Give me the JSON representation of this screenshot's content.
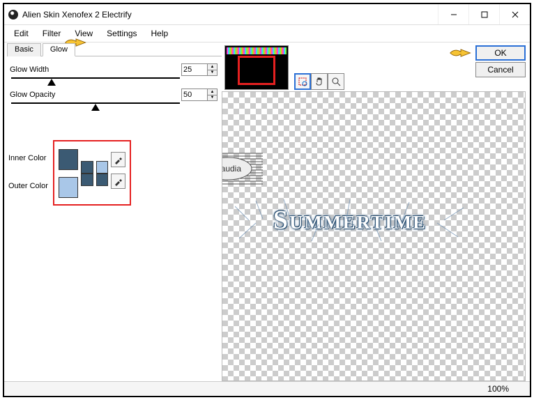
{
  "window": {
    "title": "Alien Skin Xenofex 2 Electrify"
  },
  "menu": {
    "edit": "Edit",
    "filter": "Filter",
    "view": "View",
    "settings": "Settings",
    "help": "Help"
  },
  "tabs": {
    "basic": "Basic",
    "glow": "Glow"
  },
  "controls": {
    "glow_width": {
      "label": "Glow Width",
      "value": "25",
      "thumb_pct": 24
    },
    "glow_opacity": {
      "label": "Glow Opacity",
      "value": "50",
      "thumb_pct": 50
    },
    "inner_color": {
      "label": "Inner Color",
      "big": "#3b5a73",
      "sm1": "#3b5a73",
      "sm2": "#a9c7e8"
    },
    "outer_color": {
      "label": "Outer Color",
      "big": "#a9c7e8",
      "sm1": "#3b5a73",
      "sm2": "#3b5a73"
    }
  },
  "buttons": {
    "ok": "OK",
    "cancel": "Cancel"
  },
  "canvas": {
    "text": "Summertime",
    "watermark": "claudia"
  },
  "status": {
    "zoom": "100%"
  }
}
